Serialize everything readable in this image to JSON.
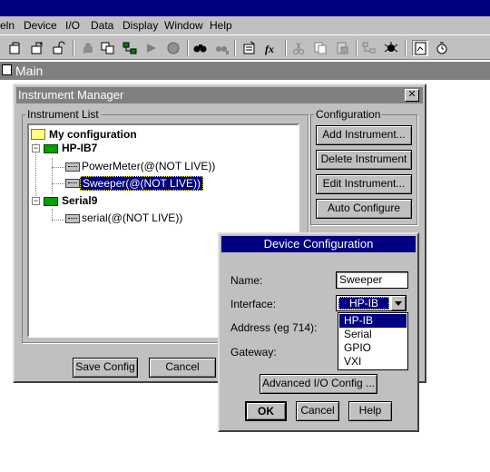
{
  "menubar": {
    "items": [
      "eln",
      "Device",
      "I/O",
      "Data",
      "Display",
      "Window",
      "Help"
    ]
  },
  "toolbar": {
    "icons": [
      "open-icon",
      "save-icon",
      "unlock-icon",
      "hand-icon",
      "copy-icon",
      "hierarchy-icon",
      "circle-icon",
      "find-icon",
      "replace-icon",
      "form-icon",
      "function-icon",
      "cut-icon",
      "paste-icon",
      "delete-icon",
      "tree-icon",
      "debug-icon",
      "properties-icon",
      "timer-icon"
    ]
  },
  "main_window": {
    "title": "Main"
  },
  "instrument_manager": {
    "title": "Instrument Manager",
    "close_symbol": "✕",
    "list_label": "Instrument List",
    "tree": {
      "root": "My configuration",
      "groups": [
        {
          "name": "HP-IB7",
          "children": [
            "PowerMeter(@(NOT LIVE))",
            "Sweeper(@(NOT LIVE))"
          ]
        },
        {
          "name": "Serial9",
          "children": [
            "serial(@(NOT LIVE))"
          ]
        }
      ],
      "selected": "Sweeper(@(NOT LIVE))"
    },
    "config_label": "Configuration",
    "buttons": {
      "add": "Add Instrument...",
      "delete": "Delete Instrument",
      "edit": "Edit Instrument...",
      "auto": "Auto Configure",
      "save": "Save Config",
      "cancel": "Cancel"
    }
  },
  "device_config": {
    "title": "Device Configuration",
    "name_label": "Name:",
    "name_value": "Sweeper",
    "interface_label": "Interface:",
    "interface_value": "HP-IB",
    "address_label": "Address (eg 714):",
    "gateway_label": "Gateway:",
    "interface_options": [
      "HP-IB",
      "Serial",
      "GPIO",
      "VXI"
    ],
    "advanced_button": "Advanced I/O Config ...",
    "ok": "OK",
    "cancel": "Cancel",
    "help": "Help"
  },
  "colors": {
    "title_active": "#000080",
    "title_inactive": "#808080",
    "face": "#c0c0c0"
  }
}
